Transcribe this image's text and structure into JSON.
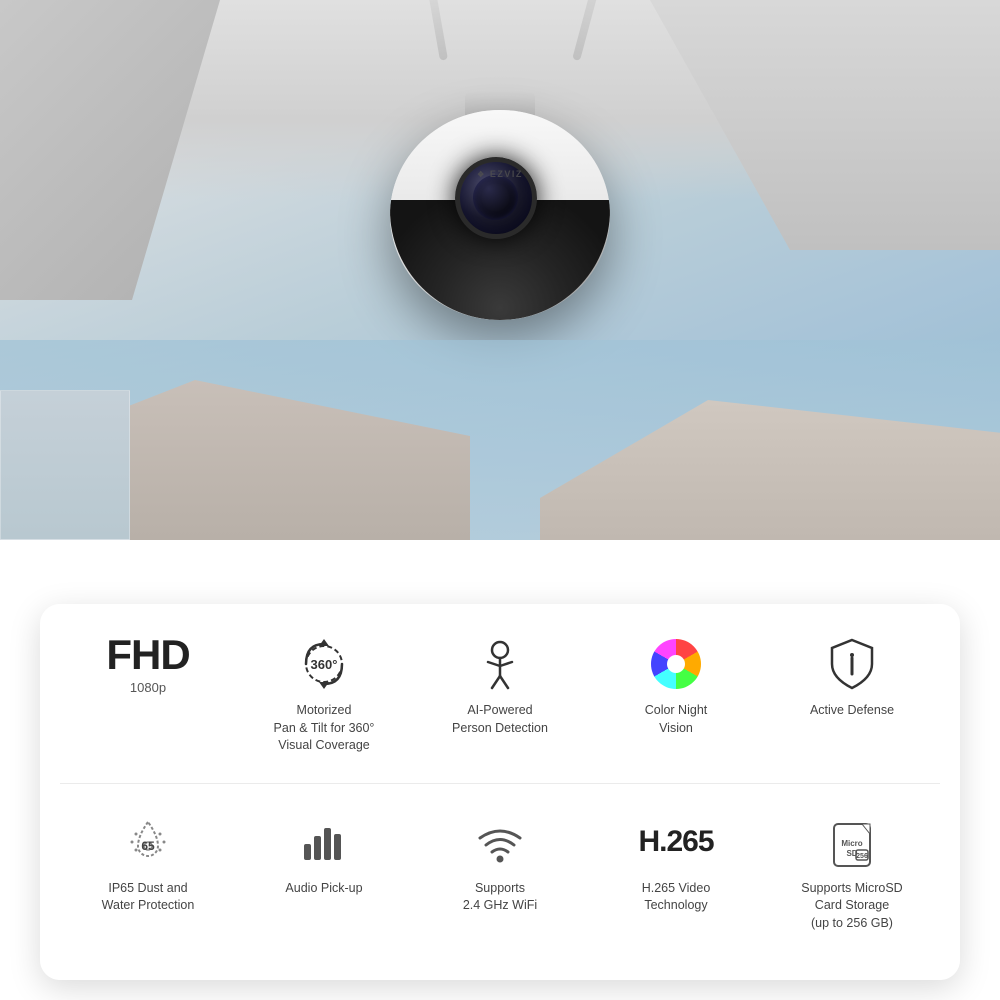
{
  "hero": {
    "brand": "EZVIZ",
    "brand_icon": "❖"
  },
  "features_row1": [
    {
      "id": "fhd",
      "title": "FHD",
      "subtitle": "1080p",
      "icon_type": "text-fhd",
      "label": "FHD",
      "sub_label": "1080p"
    },
    {
      "id": "pan-tilt",
      "title": "Motorized Pan & Tilt for 360° Visual Coverage",
      "icon_type": "360",
      "label": "Motorized\nPan & Tilt for 360°\nVisual Coverage"
    },
    {
      "id": "ai-person",
      "title": "AI-Powered Person Detection",
      "icon_type": "person",
      "label": "AI-Powered\nPerson Detection"
    },
    {
      "id": "color-night",
      "title": "Color Night Vision",
      "icon_type": "color-wheel",
      "label": "Color Night\nVision"
    },
    {
      "id": "active-defense",
      "title": "Active Defense",
      "icon_type": "shield",
      "label": "Active Defense"
    }
  ],
  "features_row2": [
    {
      "id": "ip65",
      "title": "IP65 Dust and Water Protection",
      "icon_type": "ip65",
      "label": "IP65 Dust and\nWater Protection"
    },
    {
      "id": "audio",
      "title": "Audio Pick-up",
      "icon_type": "audio",
      "label": "Audio Pick-up"
    },
    {
      "id": "wifi",
      "title": "Supports 2.4 GHz WiFi",
      "icon_type": "wifi",
      "label": "Supports\n2.4 GHz WiFi"
    },
    {
      "id": "h265",
      "title": "H.265 Video Technology",
      "icon_type": "h265",
      "label": "H.265 Video\nTechnology"
    },
    {
      "id": "sd-card",
      "title": "Supports MicroSD Card Storage (up to 256 GB)",
      "icon_type": "sd",
      "label": "Supports MicroSD\nCard Storage\n(up to 256 GB)"
    }
  ],
  "labels": {
    "fhd": "FHD",
    "fhd_sub": "1080p",
    "pan_tilt": "Motorized\nPan & Tilt for 360°\nVisual Coverage",
    "ai_person": "AI-Powered\nPerson Detection",
    "color_night": "Color Night\nVision",
    "active_defense": "Active Defense",
    "ip65": "IP65 Dust and\nWater Protection",
    "audio": "Audio Pick-up",
    "wifi": "Supports\n2.4 GHz WiFi",
    "h265_sub": "H.265 Video\nTechnology",
    "sd": "Supports MicroSD\nCard Storage\n(up to 256 GB)"
  }
}
